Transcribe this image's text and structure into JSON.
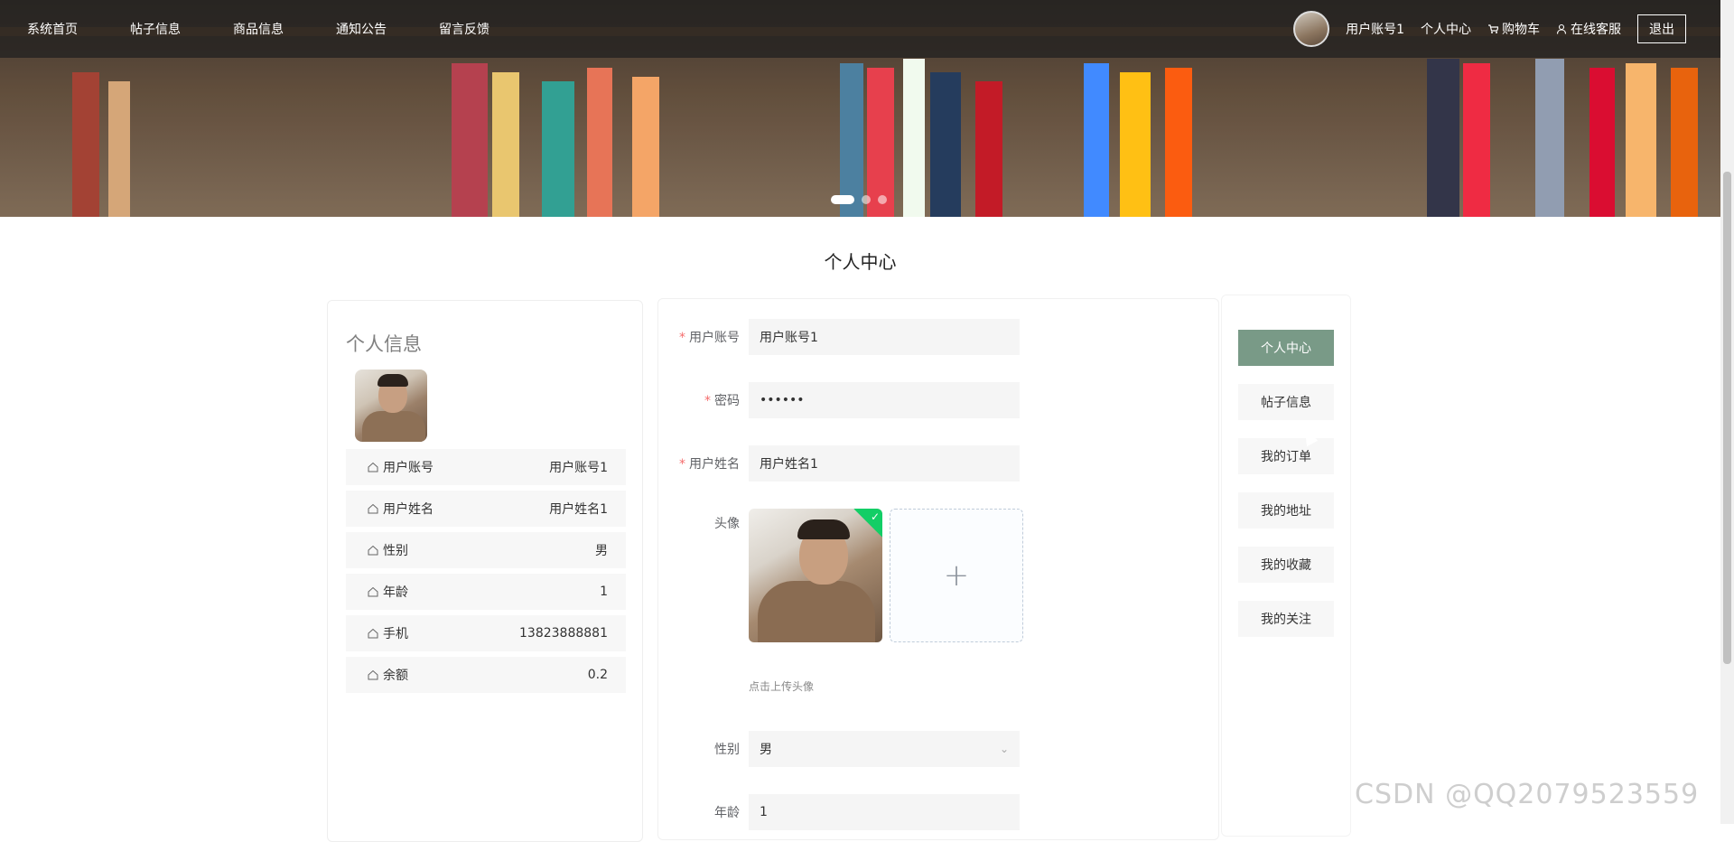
{
  "nav": {
    "items": [
      "系统首页",
      "帖子信息",
      "商品信息",
      "通知公告",
      "留言反馈"
    ],
    "username": "用户账号1",
    "personal_center": "个人中心",
    "cart": "购物车",
    "service": "在线客服",
    "logout": "退出"
  },
  "page_title": "个人中心",
  "profile": {
    "title": "个人信息",
    "rows": [
      {
        "label": "用户账号",
        "value": "用户账号1"
      },
      {
        "label": "用户姓名",
        "value": "用户姓名1"
      },
      {
        "label": "性别",
        "value": "男"
      },
      {
        "label": "年龄",
        "value": "1"
      },
      {
        "label": "手机",
        "value": "13823888881"
      },
      {
        "label": "余额",
        "value": "0.2"
      }
    ]
  },
  "form": {
    "account_label": "用户账号",
    "account_value": "用户账号1",
    "password_label": "密码",
    "password_value": "••••••",
    "name_label": "用户姓名",
    "name_value": "用户姓名1",
    "avatar_label": "头像",
    "upload_tip": "点击上传头像",
    "gender_label": "性别",
    "gender_value": "男",
    "age_label": "年龄",
    "age_value": "1"
  },
  "menu": {
    "items": [
      "个人中心",
      "帖子信息",
      "我的订单",
      "我的地址",
      "我的收藏",
      "我的关注"
    ]
  },
  "watermark": "CSDN @QQ2079523559",
  "colors": {
    "accent": "#799a87",
    "required": "#f56c6c",
    "success": "#13ce66"
  }
}
